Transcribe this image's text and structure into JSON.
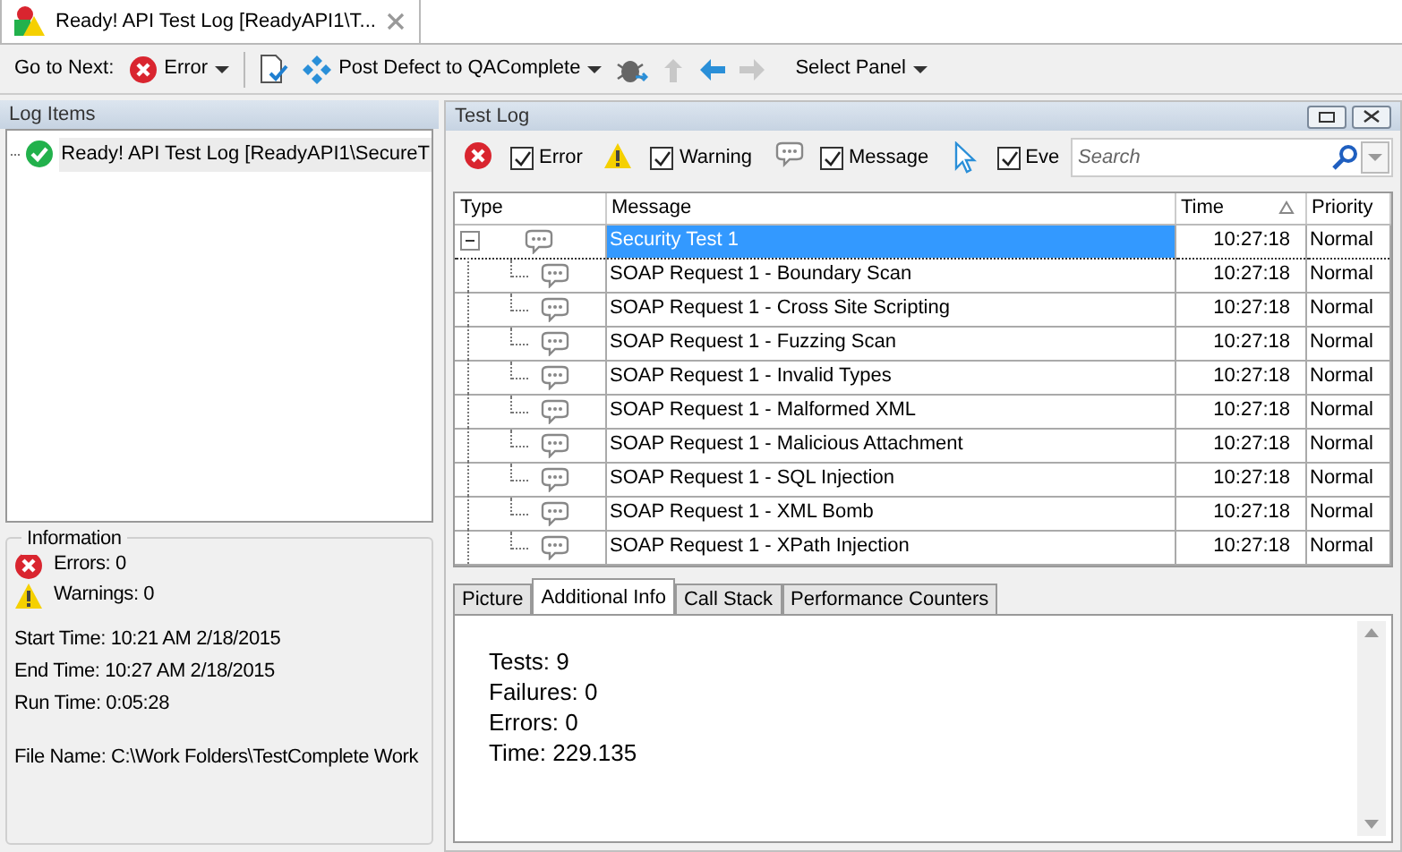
{
  "document_tab": {
    "title": "Ready! API Test Log [ReadyAPI1\\T...",
    "selected": true
  },
  "toolbar": {
    "go_to_next": "Go to Next:",
    "error_filter": "Error",
    "post_defect": "Post Defect to QAComplete",
    "select_panel": "Select Panel",
    "nav_buttons": [
      {
        "kind": "up",
        "disabled": true
      },
      {
        "kind": "back",
        "disabled": false
      },
      {
        "kind": "forward",
        "disabled": true
      }
    ]
  },
  "log_items": {
    "title": "Log Items",
    "items": [
      {
        "label": "Ready! API Test Log [ReadyAPI1\\SecureT",
        "selected": true
      }
    ]
  },
  "information": {
    "title": "Information",
    "errors": "Errors: 0",
    "warnings": "Warnings: 0",
    "details": [
      "Start Time: 10:21 AM 2/18/2015",
      "End Time: 10:27 AM 2/18/2015",
      "Run Time: 0:05:28"
    ],
    "file_name": "File Name: C:\\Work Folders\\TestComplete Work"
  },
  "test_log": {
    "title": "Test Log",
    "filters": [
      {
        "kind": "error",
        "label": "Error",
        "checked": true
      },
      {
        "kind": "warning",
        "label": "Warning",
        "checked": true
      },
      {
        "kind": "message",
        "label": "Message",
        "checked": true
      },
      {
        "kind": "event",
        "label": "Eve",
        "checked": true
      }
    ],
    "search": {
      "placeholder": "Search"
    },
    "columns": [
      {
        "label": "Type",
        "sorted": false
      },
      {
        "label": "Message",
        "sorted": false
      },
      {
        "label": "Time",
        "sorted": true
      },
      {
        "label": "Priority",
        "sorted": false
      }
    ],
    "rows": [
      {
        "message": "Security Test 1",
        "time": "10:27:18",
        "priority": "Normal",
        "selected": true,
        "expanded": true,
        "children": [
          {
            "message": "SOAP Request 1 - Boundary Scan",
            "time": "10:27:18",
            "priority": "Normal",
            "selected": false
          },
          {
            "message": "SOAP Request 1 - Cross Site Scripting",
            "time": "10:27:18",
            "priority": "Normal",
            "selected": false
          },
          {
            "message": "SOAP Request 1 - Fuzzing Scan",
            "time": "10:27:18",
            "priority": "Normal",
            "selected": false
          },
          {
            "message": "SOAP Request 1 - Invalid Types",
            "time": "10:27:18",
            "priority": "Normal",
            "selected": false
          },
          {
            "message": "SOAP Request 1 - Malformed XML",
            "time": "10:27:18",
            "priority": "Normal",
            "selected": false
          },
          {
            "message": "SOAP Request 1 - Malicious Attachment",
            "time": "10:27:18",
            "priority": "Normal",
            "selected": false
          },
          {
            "message": "SOAP Request 1 - SQL Injection",
            "time": "10:27:18",
            "priority": "Normal",
            "selected": false
          },
          {
            "message": "SOAP Request 1 - XML Bomb",
            "time": "10:27:18",
            "priority": "Normal",
            "selected": false
          },
          {
            "message": "SOAP Request 1 - XPath Injection",
            "time": "10:27:18",
            "priority": "Normal",
            "selected": false
          }
        ]
      }
    ]
  },
  "detail_tabs": [
    {
      "label": "Picture",
      "selected": false
    },
    {
      "label": "Additional Info",
      "selected": true
    },
    {
      "label": "Call Stack",
      "selected": false
    },
    {
      "label": "Performance Counters",
      "selected": false
    }
  ],
  "additional_info": [
    "Tests: 9",
    "Failures: 0",
    "Errors: 0",
    "Time: 229.135"
  ]
}
